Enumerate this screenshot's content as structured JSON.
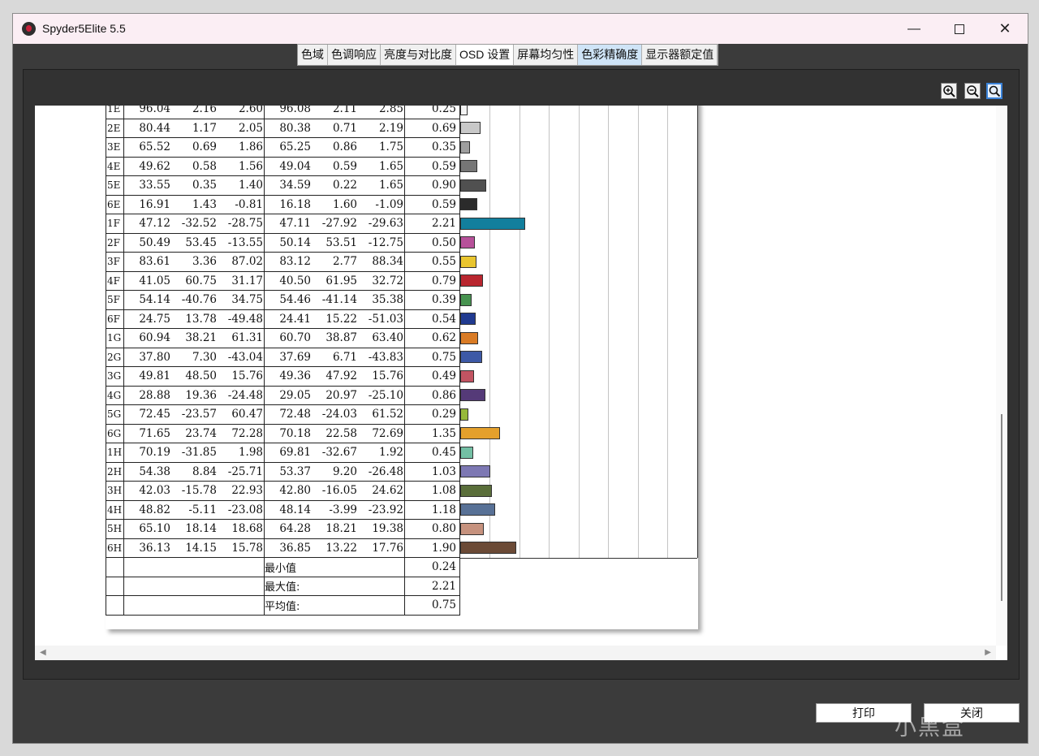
{
  "window": {
    "title": "Spyder5Elite 5.5"
  },
  "tabs": [
    "色域",
    "色调响应",
    "亮度与对比度",
    "OSD 设置",
    "屏幕均匀性",
    "色彩精确度",
    "显示器额定值"
  ],
  "rows": [
    {
      "id": "1E",
      "v": [
        "96.04",
        "2.16",
        "2.60",
        "96.08",
        "2.11",
        "2.85"
      ],
      "de": "0.25",
      "color": "#f4f4f4"
    },
    {
      "id": "2E",
      "v": [
        "80.44",
        "1.17",
        "2.05",
        "80.38",
        "0.71",
        "2.19"
      ],
      "de": "0.69",
      "color": "#c8c8c8"
    },
    {
      "id": "3E",
      "v": [
        "65.52",
        "0.69",
        "1.86",
        "65.25",
        "0.86",
        "1.75"
      ],
      "de": "0.35",
      "color": "#9e9e9e"
    },
    {
      "id": "4E",
      "v": [
        "49.62",
        "0.58",
        "1.56",
        "49.04",
        "0.59",
        "1.65"
      ],
      "de": "0.59",
      "color": "#767676"
    },
    {
      "id": "5E",
      "v": [
        "33.55",
        "0.35",
        "1.40",
        "34.59",
        "0.22",
        "1.65"
      ],
      "de": "0.90",
      "color": "#505050"
    },
    {
      "id": "6E",
      "v": [
        "16.91",
        "1.43",
        "-0.81",
        "16.18",
        "1.60",
        "-1.09"
      ],
      "de": "0.59",
      "color": "#2b2b2b"
    },
    {
      "id": "1F",
      "v": [
        "47.12",
        "-32.52",
        "-28.75",
        "47.11",
        "-27.92",
        "-29.63"
      ],
      "de": "2.21",
      "color": "#127f9d"
    },
    {
      "id": "2F",
      "v": [
        "50.49",
        "53.45",
        "-13.55",
        "50.14",
        "53.51",
        "-12.75"
      ],
      "de": "0.50",
      "color": "#b7519a"
    },
    {
      "id": "3F",
      "v": [
        "83.61",
        "3.36",
        "87.02",
        "83.12",
        "2.77",
        "88.34"
      ],
      "de": "0.55",
      "color": "#e9c52e"
    },
    {
      "id": "4F",
      "v": [
        "41.05",
        "60.75",
        "31.17",
        "40.50",
        "61.95",
        "32.72"
      ],
      "de": "0.79",
      "color": "#b9262f"
    },
    {
      "id": "5F",
      "v": [
        "54.14",
        "-40.76",
        "34.75",
        "54.46",
        "-41.14",
        "35.38"
      ],
      "de": "0.39",
      "color": "#479350"
    },
    {
      "id": "6F",
      "v": [
        "24.75",
        "13.78",
        "-49.48",
        "24.41",
        "15.22",
        "-51.03"
      ],
      "de": "0.54",
      "color": "#203a90"
    },
    {
      "id": "1G",
      "v": [
        "60.94",
        "38.21",
        "61.31",
        "60.70",
        "38.87",
        "63.40"
      ],
      "de": "0.62",
      "color": "#d97b25"
    },
    {
      "id": "2G",
      "v": [
        "37.80",
        "7.30",
        "-43.04",
        "37.69",
        "6.71",
        "-43.83"
      ],
      "de": "0.75",
      "color": "#3d59a6"
    },
    {
      "id": "3G",
      "v": [
        "49.81",
        "48.50",
        "15.76",
        "49.36",
        "47.92",
        "15.76"
      ],
      "de": "0.49",
      "color": "#c25462"
    },
    {
      "id": "4G",
      "v": [
        "28.88",
        "19.36",
        "-24.48",
        "29.05",
        "20.97",
        "-25.10"
      ],
      "de": "0.86",
      "color": "#553a78"
    },
    {
      "id": "5G",
      "v": [
        "72.45",
        "-23.57",
        "60.47",
        "72.48",
        "-24.03",
        "61.52"
      ],
      "de": "0.29",
      "color": "#96b83a"
    },
    {
      "id": "6G",
      "v": [
        "71.65",
        "23.74",
        "72.28",
        "70.18",
        "22.58",
        "72.69"
      ],
      "de": "1.35",
      "color": "#e4a02c"
    },
    {
      "id": "1H",
      "v": [
        "70.19",
        "-31.85",
        "1.98",
        "69.81",
        "-32.67",
        "1.92"
      ],
      "de": "0.45",
      "color": "#73bfa4"
    },
    {
      "id": "2H",
      "v": [
        "54.38",
        "8.84",
        "-25.71",
        "53.37",
        "9.20",
        "-26.48"
      ],
      "de": "1.03",
      "color": "#7d78b3"
    },
    {
      "id": "3H",
      "v": [
        "42.03",
        "-15.78",
        "22.93",
        "42.80",
        "-16.05",
        "24.62"
      ],
      "de": "1.08",
      "color": "#5a6e3a"
    },
    {
      "id": "4H",
      "v": [
        "48.82",
        "-5.11",
        "-23.08",
        "48.14",
        "-3.99",
        "-23.92"
      ],
      "de": "1.18",
      "color": "#587196"
    },
    {
      "id": "5H",
      "v": [
        "65.10",
        "18.14",
        "18.68",
        "64.28",
        "18.21",
        "19.38"
      ],
      "de": "0.80",
      "color": "#c6927e"
    },
    {
      "id": "6H",
      "v": [
        "36.13",
        "14.15",
        "15.78",
        "36.85",
        "13.22",
        "17.76"
      ],
      "de": "1.90",
      "color": "#6b4a36"
    }
  ],
  "summary": [
    {
      "label": "最小值",
      "value": "0.24"
    },
    {
      "label": "最大值:",
      "value": "2.21"
    },
    {
      "label": "平均值:",
      "value": "0.75"
    }
  ],
  "buttons": {
    "print": "打印",
    "close": "关闭"
  },
  "watermark": "小黑盒"
}
